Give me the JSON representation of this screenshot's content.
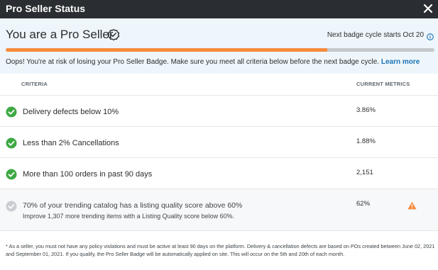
{
  "window": {
    "title": "Pro Seller Status"
  },
  "header": {
    "heading": "You are a Pro Seller",
    "cycle_text": "Next badge cycle starts Oct 20",
    "progress_percent": 75,
    "warning_text": "Oops! You're at risk of losing your Pro Seller Badge. Make sure you meet all criteria below before the next badge cycle. ",
    "learn_more": "Learn more"
  },
  "table": {
    "col_criteria": "CRITERIA",
    "col_metrics": "CURRENT METRICS",
    "rows": [
      {
        "label": "Delivery defects below 10%",
        "metric": "3.86%",
        "status": "met"
      },
      {
        "label": "Less than 2% Cancellations",
        "metric": "1.88%",
        "status": "met"
      },
      {
        "label": "More than 100 orders in past 90 days",
        "metric": "2,151",
        "status": "met"
      },
      {
        "label": "70% of your trending catalog has a listing quality score above 60%",
        "sub": "Improve 1,307 more trending items with a Listing Quality score below 60%.",
        "metric": "62%",
        "status": "not-met"
      }
    ]
  },
  "footer": {
    "note": "* As a seller, you must not have any policy violations and must be active at least 90 days on the platform. Delivery & cancellation defects are based on POs created between June 02, 2021 and September 01, 2021. If you qualify, the Pro Seller Badge will be automatically applied on site. This will occur on the 5th and 20th of each month."
  },
  "colors": {
    "accent_orange": "#f58b3b",
    "success_green": "#3ea843",
    "link_blue": "#1a73b5",
    "titlebar": "#2a2d31",
    "header_bg": "#eef6fb"
  },
  "icons": {
    "close": "close-icon",
    "badge": "badge-check-icon",
    "info": "info-icon",
    "check": "check-circle-icon",
    "alert": "warning-triangle-icon"
  }
}
